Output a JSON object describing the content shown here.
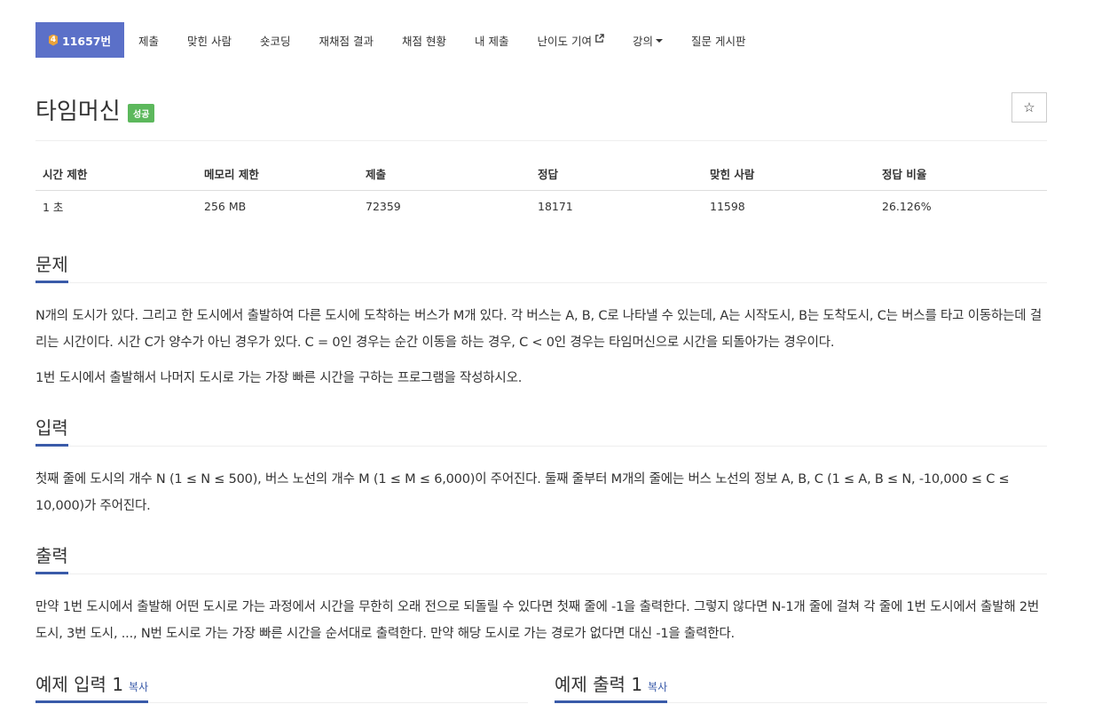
{
  "menu": {
    "problem_number": "11657번",
    "tier_glyph": "4",
    "items": [
      "제출",
      "맞힌 사람",
      "숏코딩",
      "재채점 결과",
      "채점 현황",
      "내 제출",
      "난이도 기여",
      "강의",
      "질문 게시판"
    ]
  },
  "title": "타임머신",
  "badge": "성공",
  "star_glyph": "☆",
  "info": {
    "headers": [
      "시간 제한",
      "메모리 제한",
      "제출",
      "정답",
      "맞힌 사람",
      "정답 비율"
    ],
    "values": [
      "1 초",
      "256 MB",
      "72359",
      "18171",
      "11598",
      "26.126%"
    ]
  },
  "sections": {
    "problem": {
      "heading": "문제",
      "paragraphs": [
        "N개의 도시가 있다. 그리고 한 도시에서 출발하여 다른 도시에 도착하는 버스가 M개 있다. 각 버스는 A, B, C로 나타낼 수 있는데, A는 시작도시, B는 도착도시, C는 버스를 타고 이동하는데 걸리는 시간이다. 시간 C가 양수가 아닌 경우가 있다. C = 0인 경우는 순간 이동을 하는 경우, C < 0인 경우는 타임머신으로 시간을 되돌아가는 경우이다.",
        "1번 도시에서 출발해서 나머지 도시로 가는 가장 빠른 시간을 구하는 프로그램을 작성하시오."
      ]
    },
    "input": {
      "heading": "입력",
      "paragraphs": [
        "첫째 줄에 도시의 개수 N (1 ≤ N ≤ 500), 버스 노선의 개수 M (1 ≤ M ≤ 6,000)이 주어진다. 둘째 줄부터 M개의 줄에는 버스 노선의 정보 A, B, C (1 ≤ A, B ≤ N, -10,000 ≤ C ≤ 10,000)가 주어진다."
      ]
    },
    "output": {
      "heading": "출력",
      "paragraphs": [
        "만약 1번 도시에서 출발해 어떤 도시로 가는 과정에서 시간을 무한히 오래 전으로 되돌릴 수 있다면 첫째 줄에 -1을 출력한다. 그렇지 않다면 N-1개 줄에 걸쳐 각 줄에 1번 도시에서 출발해 2번 도시, 3번 도시, ..., N번 도시로 가는 가장 빠른 시간을 순서대로 출력한다. 만약 해당 도시로 가는 경로가 없다면 대신 -1을 출력한다."
      ]
    }
  },
  "samples": {
    "input_heading": "예제 입력 1",
    "output_heading": "예제 출력 1",
    "copy_label": "복사"
  }
}
